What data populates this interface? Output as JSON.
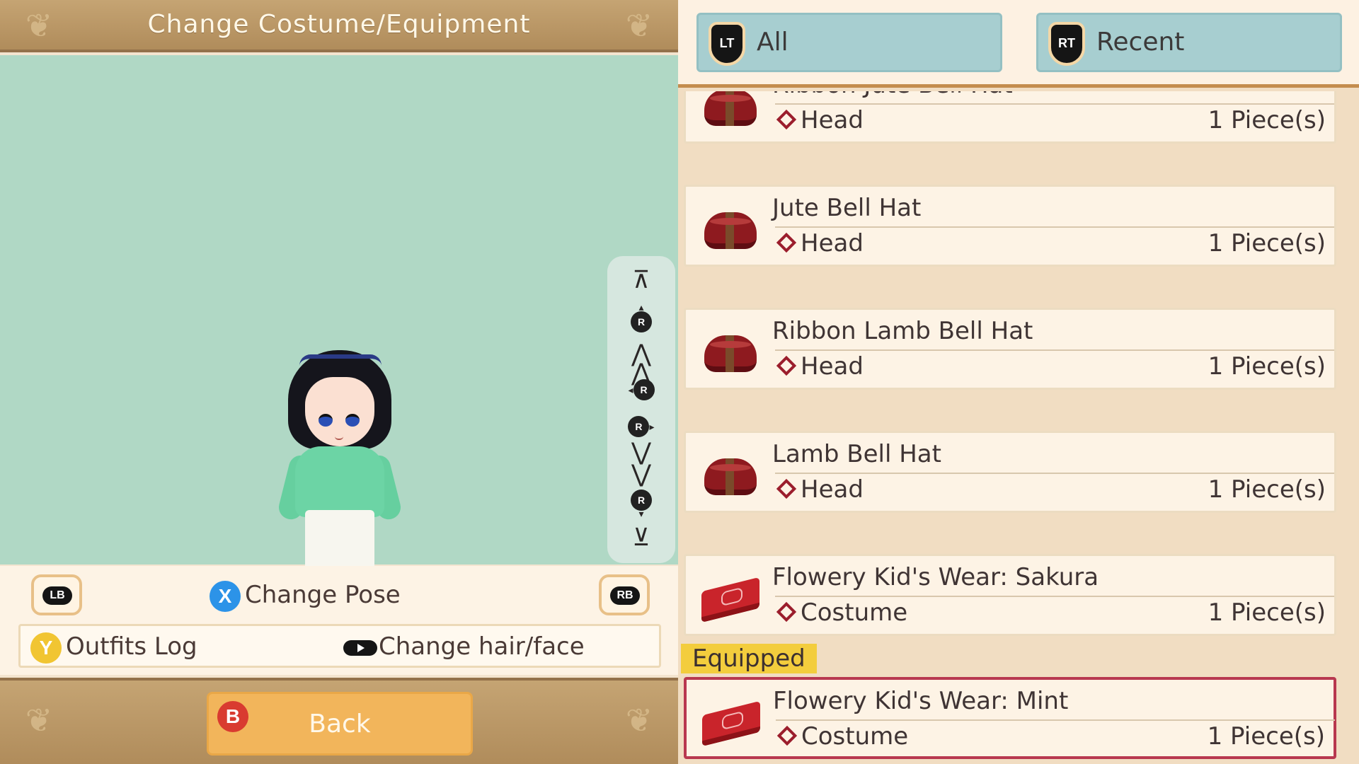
{
  "header": {
    "title": "Change Costume/Equipment"
  },
  "camera_controls": [
    {
      "name": "cam-zoom-in-max",
      "glyph": "⊼"
    },
    {
      "name": "cam-up",
      "glyph": "R"
    },
    {
      "name": "cam-zoom-in",
      "glyph": "⋀"
    },
    {
      "name": "cam-rotate-left",
      "glyph": "R"
    },
    {
      "name": "cam-rotate-right",
      "glyph": "R"
    },
    {
      "name": "cam-zoom-out",
      "glyph": "⋁"
    },
    {
      "name": "cam-down",
      "glyph": "R"
    },
    {
      "name": "cam-zoom-out-max",
      "glyph": "⊻"
    }
  ],
  "controls": {
    "lb_label": "LB",
    "rb_label": "RB",
    "pose_button": "X",
    "change_pose": "Change Pose",
    "outfits_button": "Y",
    "outfits_log": "Outfits Log",
    "change_hair_face": "Change hair/face"
  },
  "footer": {
    "back_button": "B",
    "back_label": "Back"
  },
  "tabs": [
    {
      "button": "LT",
      "label": "All"
    },
    {
      "button": "RT",
      "label": "Recent"
    }
  ],
  "items": [
    {
      "name": "Ribbon Jute Bell Hat",
      "category": "Head",
      "quantity": "1 Piece(s)",
      "icon": "hatbox-icon"
    },
    {
      "name": "Jute Bell Hat",
      "category": "Head",
      "quantity": "1 Piece(s)",
      "icon": "hatbox-icon"
    },
    {
      "name": "Ribbon Lamb Bell Hat",
      "category": "Head",
      "quantity": "1 Piece(s)",
      "icon": "hatbox-icon"
    },
    {
      "name": "Lamb Bell Hat",
      "category": "Head",
      "quantity": "1 Piece(s)",
      "icon": "hatbox-icon"
    },
    {
      "name": "Flowery Kid's Wear: Sakura",
      "category": "Costume",
      "quantity": "1 Piece(s)",
      "icon": "costume-box-icon"
    },
    {
      "name": "Flowery Kid's Wear: Mint",
      "category": "Costume",
      "quantity": "1 Piece(s)",
      "icon": "costume-box-icon",
      "equipped": true,
      "selected": true
    }
  ],
  "equipped_label": "Equipped",
  "colors": {
    "accent": "#e6a151",
    "selection": "#b8384f",
    "equipped_badge": "#f3cd3d",
    "viewport": "#b0d8c5"
  }
}
